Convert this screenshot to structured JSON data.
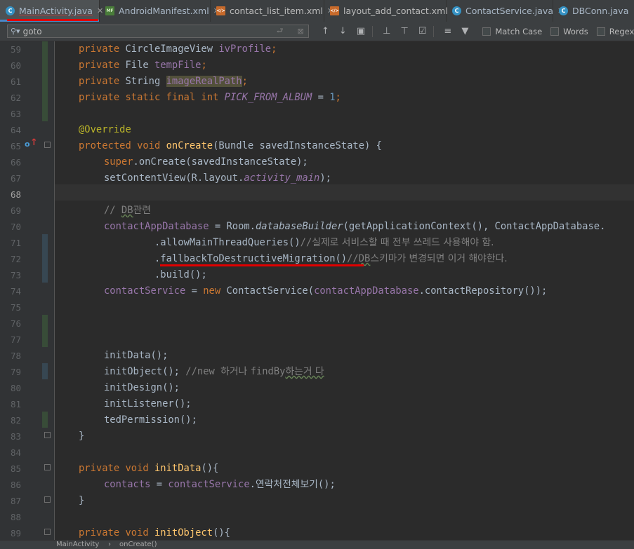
{
  "tabs": [
    {
      "label": "MainActivity.java",
      "icon": "class-file-icon",
      "active": true,
      "close": "✕"
    },
    {
      "label": "AndroidManifest.xml",
      "icon": "manifest-file-icon",
      "active": false,
      "close": "✕"
    },
    {
      "label": "contact_list_item.xml",
      "icon": "xml-file-icon",
      "active": false,
      "close": "✕"
    },
    {
      "label": "layout_add_contact.xml",
      "icon": "xml-file-icon",
      "active": false,
      "close": "✕"
    },
    {
      "label": "ContactService.java",
      "icon": "class-file-icon",
      "active": false,
      "close": "✕"
    },
    {
      "label": "DBConn.java",
      "icon": "class-file-icon",
      "active": false,
      "close": ""
    }
  ],
  "find_bar": {
    "query": "goto",
    "match_case_label": "Match Case",
    "words_label": "Words",
    "regex_label": "Regex"
  },
  "editor": {
    "line_numbers": [
      "59",
      "60",
      "61",
      "62",
      "63",
      "64",
      "65",
      "66",
      "67",
      "68",
      "69",
      "70",
      "71",
      "72",
      "73",
      "74",
      "75",
      "76",
      "77",
      "78",
      "79",
      "80",
      "81",
      "82",
      "83",
      "84",
      "85",
      "86",
      "87",
      "88",
      "89"
    ],
    "code": {
      "l59": {
        "kw": "private ",
        "type": "CircleImageView ",
        "fld": "ivProfile",
        "end": ";"
      },
      "l60": {
        "kw": "private ",
        "type": "File ",
        "fld": "tempFile",
        "end": ";"
      },
      "l61": {
        "kw": "private ",
        "type": "String ",
        "fld": "imageRealPath",
        "end": ";"
      },
      "l62": {
        "kw": "private static final int ",
        "fld": "PICK_FROM_ALBUM",
        "op": " = ",
        "num": "1",
        "end": ";"
      },
      "l64": {
        "ann": "@Override"
      },
      "l65": {
        "kw": "protected void ",
        "fn": "onCreate",
        "rest": "(Bundle savedInstanceState) {"
      },
      "l66": {
        "kw": "super",
        "rest": ".onCreate(savedInstanceState);"
      },
      "l67": {
        "pre": "setContentView(R.layout.",
        "st": "activity_main",
        "end": ");"
      },
      "l69": {
        "cmt": "// ",
        "cmt2": "DB",
        "kor": "관련"
      },
      "l70": {
        "fld": "contactAppDatabase",
        "mid": " = Room.",
        "st": "databaseBuilder",
        "rest": "(getApplicationContext(), ContactAppDatabase."
      },
      "l71": {
        "code": ".allowMainThreadQueries()",
        "cmt": "//",
        "kor": "실제로 서비스할 때 전부 쓰레드 사용해야 함."
      },
      "l72": {
        "code": ".fallbackToDestructiveMigration()",
        "cmt": "//",
        "cmt2": "DB",
        "kor": "스키마가 변경되면 이거 해야한다."
      },
      "l73": {
        "code": ".build();"
      },
      "l74": {
        "fld": "contactService",
        "mid": " = ",
        "kw": "new ",
        "pre": "ContactService(",
        "fld2": "contactAppDatabase",
        "rest": ".contactRepository());"
      },
      "l78": {
        "code": "initData();"
      },
      "l79": {
        "code": "initObject(); ",
        "cmt": "//new ",
        "kor1": "하거나 ",
        "cmt2": "findBy",
        "kor2": "하는거 다"
      },
      "l80": {
        "code": "initDesign();"
      },
      "l81": {
        "code": "initListener();"
      },
      "l82": {
        "code": "tedPermission();"
      },
      "l83": {
        "code": "}"
      },
      "l85": {
        "kw": "private void ",
        "fn": "initData",
        "rest": "(){"
      },
      "l86": {
        "fld": "contacts",
        "mid": " = ",
        "fld2": "contactService",
        "dot": ".",
        "kor": "연락처전체보기",
        "end": "();"
      },
      "l87": {
        "code": "}"
      },
      "l89": {
        "kw": "private void ",
        "fn": "initObject",
        "rest": "(){"
      }
    }
  },
  "breadcrumb": {
    "class_name": "MainActivity",
    "separator": "›",
    "method_name": "onCreate()"
  },
  "colors": {
    "accent": "#4a88c7",
    "keyword": "#cc7832",
    "field": "#9876aa",
    "function": "#ffc66d",
    "annotation": "#bbb529",
    "number": "#6897bb",
    "comment": "#808080",
    "text": "#a9b7c6",
    "red_mark": "#e00000"
  }
}
